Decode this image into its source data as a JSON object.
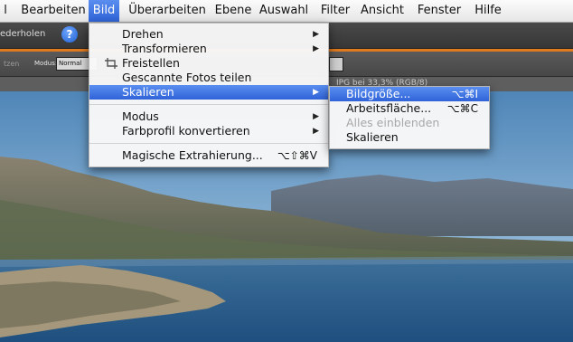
{
  "menubar": {
    "items": [
      {
        "label": "l",
        "active": false
      },
      {
        "label": "Bearbeiten",
        "active": false
      },
      {
        "label": "Bild",
        "active": true
      },
      {
        "label": "Überarbeiten",
        "active": false
      },
      {
        "label": "Ebene",
        "active": false
      },
      {
        "label": "Auswahl",
        "active": false
      },
      {
        "label": "Filter",
        "active": false
      },
      {
        "label": "Ansicht",
        "active": false
      },
      {
        "label": "Fenster",
        "active": false
      },
      {
        "label": "Hilfe",
        "active": false
      }
    ]
  },
  "toolbar": {
    "redo_label": "ederholen",
    "help_icon": "?"
  },
  "optionsbar": {
    "left_label": "tzen",
    "modus_label": "Modus:",
    "modus_value": "Normal"
  },
  "docbar": {
    "title": "IPG bei 33,3% (RGB/8)"
  },
  "bild_menu": {
    "items": [
      {
        "label": "Drehen",
        "submenu": true
      },
      {
        "label": "Transformieren",
        "submenu": true
      },
      {
        "label": "Freistellen",
        "icon": "crop-icon"
      },
      {
        "label": "Gescannte Fotos teilen"
      },
      {
        "label": "Skalieren",
        "submenu": true,
        "selected": true
      },
      {
        "label": "Modus",
        "submenu": true
      },
      {
        "label": "Farbprofil konvertieren",
        "submenu": true
      },
      {
        "label": "Magische Extrahierung...",
        "shortcut": "⌥⇧⌘V"
      }
    ]
  },
  "skalieren_menu": {
    "items": [
      {
        "label": "Bildgröße...",
        "shortcut": "⌥⌘I",
        "selected": true
      },
      {
        "label": "Arbeitsfläche...",
        "shortcut": "⌥⌘C"
      },
      {
        "label": "Alles einblenden",
        "disabled": true
      },
      {
        "label": "Skalieren"
      }
    ]
  },
  "colors": {
    "accent_orange": "#e07a1f",
    "selection_blue": "#2f63d8"
  }
}
